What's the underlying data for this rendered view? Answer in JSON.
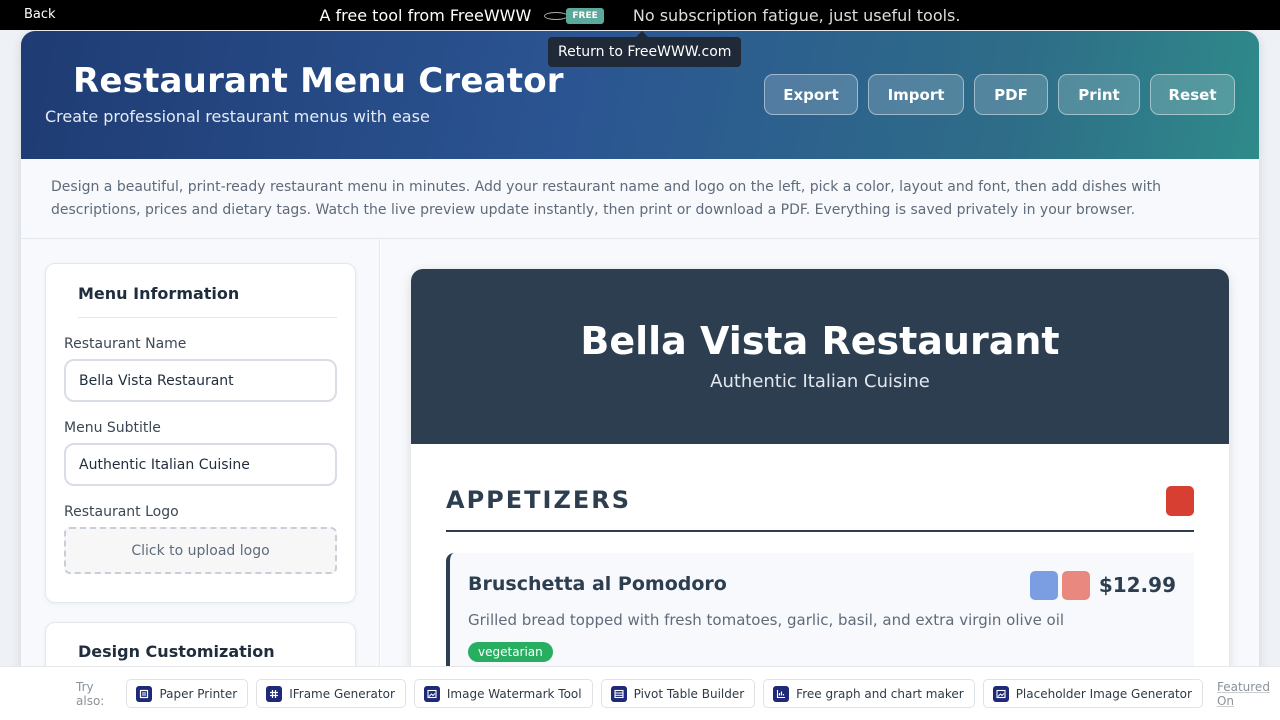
{
  "topbar": {
    "back_label": "Back",
    "promo_text": "A free tool from FreeWWW",
    "free_badge": "FREE",
    "sub_text": "No subscription fatigue, just useful tools.",
    "tooltip": "Return to FreeWWW.com"
  },
  "header": {
    "title": "Restaurant Menu Creator",
    "tagline": "Create professional restaurant menus with ease",
    "buttons": [
      "Export",
      "Import",
      "PDF",
      "Print",
      "Reset"
    ]
  },
  "intro_text": "Design a beautiful, print-ready restaurant menu in minutes. Add your restaurant name and logo on the left, pick a color, layout and font, then add dishes with descriptions, prices and dietary tags. Watch the live preview update instantly, then print or download a PDF. Everything is saved privately in your browser.",
  "sidebar": {
    "menu_info": {
      "heading": "Menu Information",
      "name_label": "Restaurant Name",
      "name_value": "Bella Vista Restaurant",
      "subtitle_label": "Menu Subtitle",
      "subtitle_value": "Authentic Italian Cuisine",
      "logo_label": "Restaurant Logo",
      "logo_upload": "Click to upload logo"
    },
    "design": {
      "heading": "Design Customization"
    }
  },
  "preview": {
    "restaurant_name": "Bella Vista Restaurant",
    "subtitle": "Authentic Italian Cuisine",
    "sections": [
      {
        "title": "APPETIZERS",
        "items": [
          {
            "name": "Bruschetta al Pomodoro",
            "price": "$12.99",
            "description": "Grilled bread topped with fresh tomatoes, garlic, basil, and extra virgin olive oil",
            "tag": "vegetarian"
          }
        ]
      }
    ]
  },
  "bottombar": {
    "try_label": "Try also:",
    "links": [
      "Paper Printer",
      "IFrame Generator",
      "Image Watermark Tool",
      "Pivot Table Builder",
      "Free graph and chart maker",
      "Placeholder Image Generator"
    ],
    "featured": "Featured On"
  },
  "colors": {
    "header_dark": "#2c3e50",
    "delete_red": "#d63f31",
    "vegetarian_green": "#27ae60",
    "brand_navy": "#1e2a78"
  }
}
